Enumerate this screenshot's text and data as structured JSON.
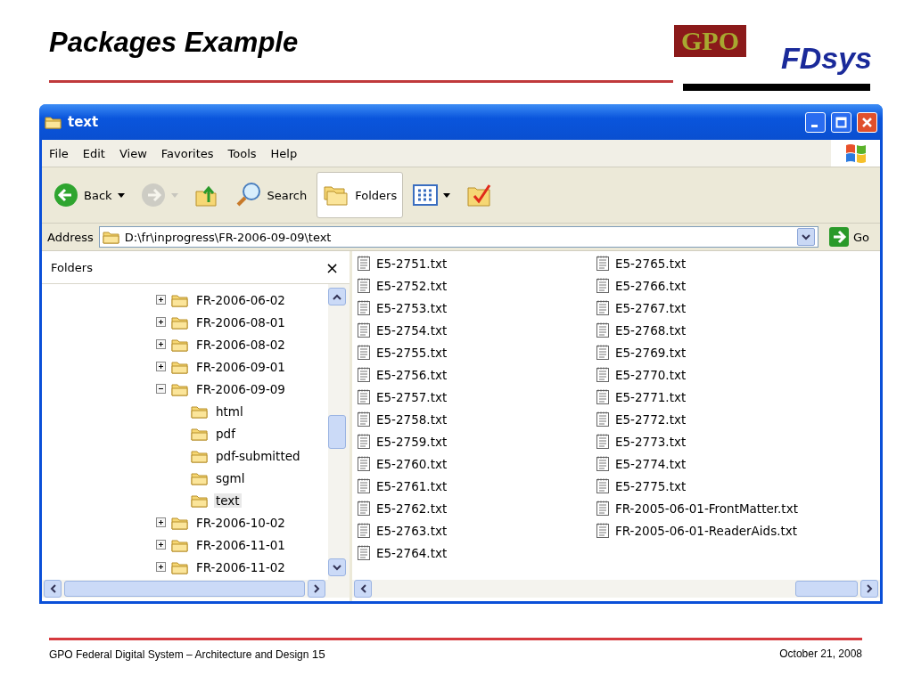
{
  "slide_title": "Packages Example",
  "logo": {
    "top": "GPO",
    "bottom": "FDsys"
  },
  "window": {
    "title": "text"
  },
  "menu": [
    "File",
    "Edit",
    "View",
    "Favorites",
    "Tools",
    "Help"
  ],
  "toolbar": [
    {
      "kind": "back",
      "label": "Back",
      "dropdown": true,
      "pressed": false,
      "disabled": false
    },
    {
      "kind": "forward",
      "dropdown": true,
      "pressed": false,
      "disabled": true
    },
    {
      "kind": "up",
      "dropdown": false,
      "pressed": false,
      "disabled": false
    },
    {
      "kind": "search",
      "label": "Search",
      "dropdown": false,
      "pressed": false,
      "disabled": false
    },
    {
      "kind": "folders",
      "label": "Folders",
      "dropdown": false,
      "pressed": true,
      "disabled": false
    },
    {
      "kind": "views",
      "dropdown": true,
      "pressed": false,
      "disabled": false
    },
    {
      "kind": "sync",
      "dropdown": false,
      "pressed": false,
      "disabled": false
    }
  ],
  "address": {
    "label": "Address",
    "value": "D:\\fr\\inprogress\\FR-2006-09-09\\text",
    "go": "Go"
  },
  "folders_pane": {
    "title": "Folders",
    "close": "×",
    "tree": [
      {
        "name": "FR-2006-06-02",
        "expanded": false,
        "selected": false
      },
      {
        "name": "FR-2006-08-01",
        "expanded": false,
        "selected": false
      },
      {
        "name": "FR-2006-08-02",
        "expanded": false,
        "selected": false
      },
      {
        "name": "FR-2006-09-01",
        "expanded": false,
        "selected": false
      },
      {
        "name": "FR-2006-09-09",
        "expanded": true,
        "selected": false,
        "children": [
          {
            "name": "html",
            "selected": false
          },
          {
            "name": "pdf",
            "selected": false
          },
          {
            "name": "pdf-submitted",
            "selected": false
          },
          {
            "name": "sgml",
            "selected": false
          },
          {
            "name": "text",
            "selected": true
          }
        ]
      },
      {
        "name": "FR-2006-10-02",
        "expanded": false,
        "selected": false
      },
      {
        "name": "FR-2006-11-01",
        "expanded": false,
        "selected": false
      },
      {
        "name": "FR-2006-11-02",
        "expanded": false,
        "selected": false
      }
    ]
  },
  "files": [
    "E5-2751.txt",
    "E5-2752.txt",
    "E5-2753.txt",
    "E5-2754.txt",
    "E5-2755.txt",
    "E5-2756.txt",
    "E5-2757.txt",
    "E5-2758.txt",
    "E5-2759.txt",
    "E5-2760.txt",
    "E5-2761.txt",
    "E5-2762.txt",
    "E5-2763.txt",
    "E5-2764.txt",
    "E5-2765.txt",
    "E5-2766.txt",
    "E5-2767.txt",
    "E5-2768.txt",
    "E5-2769.txt",
    "E5-2770.txt",
    "E5-2771.txt",
    "E5-2772.txt",
    "E5-2773.txt",
    "E5-2774.txt",
    "E5-2775.txt",
    "FR-2005-06-01-FrontMatter.txt",
    "FR-2005-06-01-ReaderAids.txt"
  ],
  "footer": {
    "text": "GPO Federal Digital System – Architecture and Design",
    "page": "15",
    "date": "October 21, 2008"
  }
}
